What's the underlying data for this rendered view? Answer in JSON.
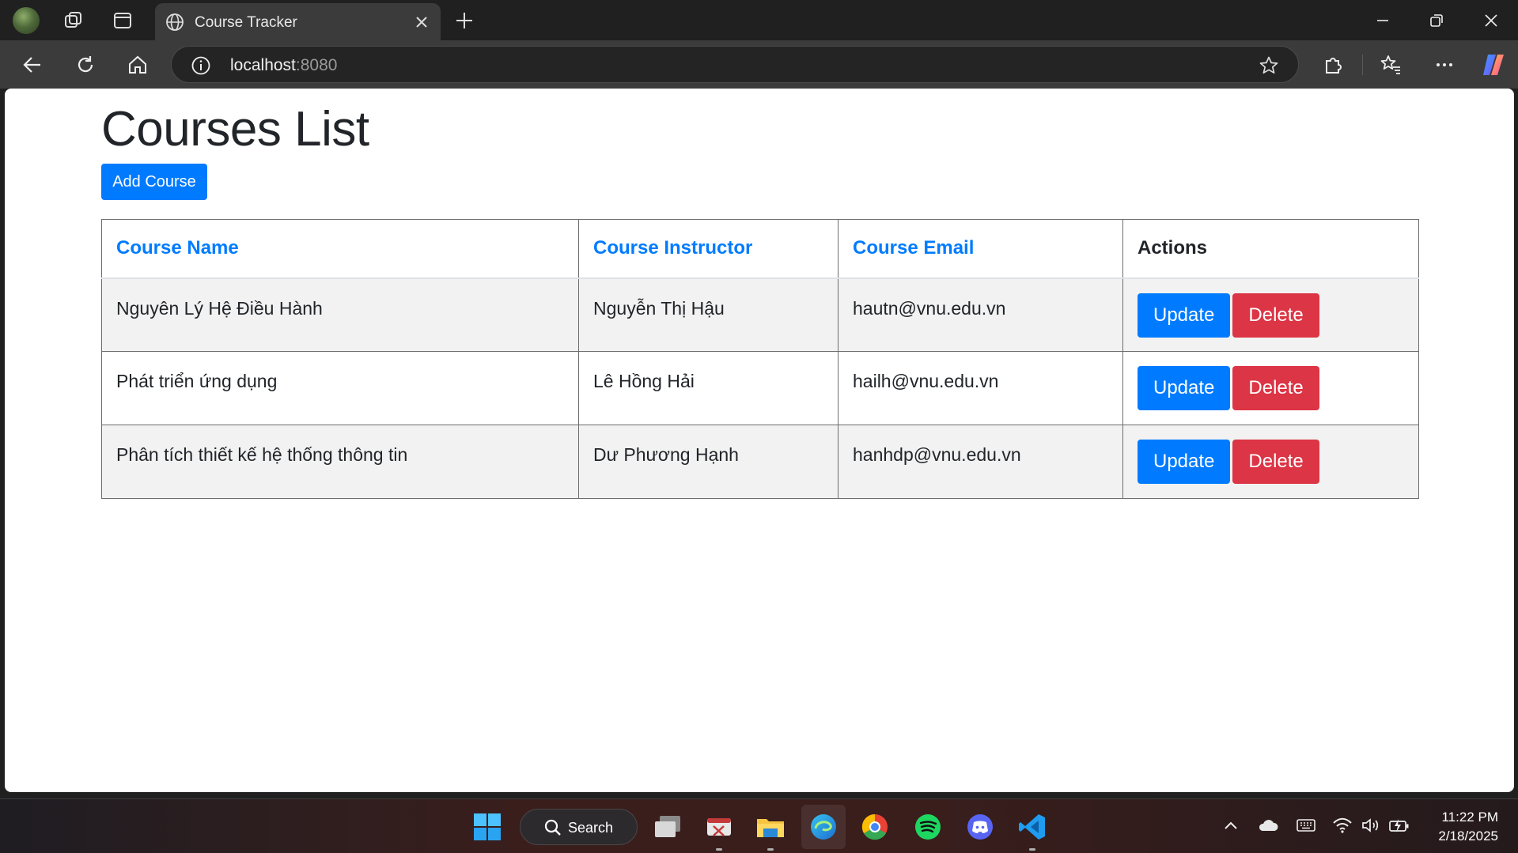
{
  "browser": {
    "tab_title": "Course Tracker",
    "url_host": "localhost",
    "url_port": ":8080"
  },
  "page": {
    "title": "Courses List",
    "add_button": "Add Course",
    "columns": [
      "Course Name",
      "Course Instructor",
      "Course Email",
      "Actions"
    ],
    "rows": [
      {
        "name": "Nguyên Lý Hệ Điều Hành",
        "instructor": "Nguyễn Thị Hậu",
        "email": "hautn@vnu.edu.vn"
      },
      {
        "name": "Phát triển ứng dụng",
        "instructor": "Lê Hồng Hải",
        "email": "hailh@vnu.edu.vn"
      },
      {
        "name": "Phân tích thiết kế hệ thống thông tin",
        "instructor": "Dư Phương Hạnh",
        "email": "hanhdp@vnu.edu.vn"
      }
    ],
    "update_label": "Update",
    "delete_label": "Delete",
    "colors": {
      "primary": "#007bff",
      "danger": "#dc3545"
    }
  },
  "taskbar": {
    "search_label": "Search",
    "time": "11:22 PM",
    "date": "2/18/2025",
    "icons": [
      "windows-start-icon",
      "task-view-icon",
      "snipping-tool-icon",
      "file-explorer-icon",
      "edge-icon",
      "chrome-icon",
      "spotify-icon",
      "discord-icon",
      "vscode-icon"
    ]
  }
}
